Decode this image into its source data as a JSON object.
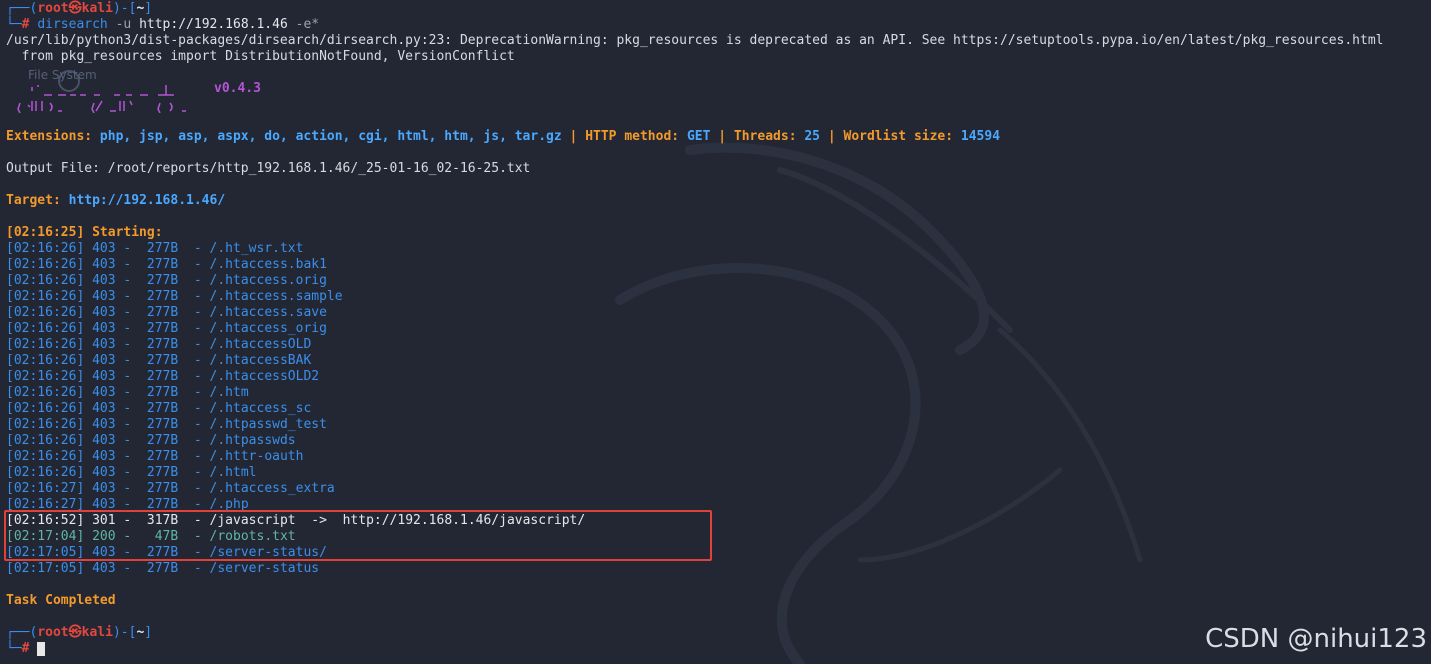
{
  "prompt1": {
    "user": "root",
    "at": "㉿",
    "host": "kali",
    "dir": "~",
    "hash": "#"
  },
  "command": {
    "name": "dirsearch",
    "flag_u": "-u",
    "url": "http://192.168.1.46",
    "flag_e": "-e*"
  },
  "warning": {
    "line1": "/usr/lib/python3/dist-packages/dirsearch/dirsearch.py:23: DeprecationWarning: pkg_resources is deprecated as an API. See https://setuptools.pypa.io/en/latest/pkg_resources.html",
    "line2": "  from pkg_resources import DistributionNotFound, VersionConflict"
  },
  "banner": {
    "version": "v0.4.3"
  },
  "config": {
    "ext_label": "Extensions:",
    "ext_value": "php, jsp, asp, aspx, do, action, cgi, html, htm, js, tar.gz",
    "method_label": "HTTP method:",
    "method_value": "GET",
    "threads_label": "Threads:",
    "threads_value": "25",
    "wordlist_label": "Wordlist size:",
    "wordlist_value": "14594",
    "sep": "|"
  },
  "output_file": "Output File: /root/reports/http_192.168.1.46/_25-01-16_02-16-25.txt",
  "target": {
    "label": "Target:",
    "url": "http://192.168.1.46/"
  },
  "starting": "[02:16:25] Starting:",
  "results": [
    {
      "time": "[02:16:26]",
      "code": "403",
      "size": "277B",
      "path": "/.ht_wsr.txt",
      "redirect": ""
    },
    {
      "time": "[02:16:26]",
      "code": "403",
      "size": "277B",
      "path": "/.htaccess.bak1",
      "redirect": ""
    },
    {
      "time": "[02:16:26]",
      "code": "403",
      "size": "277B",
      "path": "/.htaccess.orig",
      "redirect": ""
    },
    {
      "time": "[02:16:26]",
      "code": "403",
      "size": "277B",
      "path": "/.htaccess.sample",
      "redirect": ""
    },
    {
      "time": "[02:16:26]",
      "code": "403",
      "size": "277B",
      "path": "/.htaccess.save",
      "redirect": ""
    },
    {
      "time": "[02:16:26]",
      "code": "403",
      "size": "277B",
      "path": "/.htaccess_orig",
      "redirect": ""
    },
    {
      "time": "[02:16:26]",
      "code": "403",
      "size": "277B",
      "path": "/.htaccessOLD",
      "redirect": ""
    },
    {
      "time": "[02:16:26]",
      "code": "403",
      "size": "277B",
      "path": "/.htaccessBAK",
      "redirect": ""
    },
    {
      "time": "[02:16:26]",
      "code": "403",
      "size": "277B",
      "path": "/.htaccessOLD2",
      "redirect": ""
    },
    {
      "time": "[02:16:26]",
      "code": "403",
      "size": "277B",
      "path": "/.htm",
      "redirect": ""
    },
    {
      "time": "[02:16:26]",
      "code": "403",
      "size": "277B",
      "path": "/.htaccess_sc",
      "redirect": ""
    },
    {
      "time": "[02:16:26]",
      "code": "403",
      "size": "277B",
      "path": "/.htpasswd_test",
      "redirect": ""
    },
    {
      "time": "[02:16:26]",
      "code": "403",
      "size": "277B",
      "path": "/.htpasswds",
      "redirect": ""
    },
    {
      "time": "[02:16:26]",
      "code": "403",
      "size": "277B",
      "path": "/.httr-oauth",
      "redirect": ""
    },
    {
      "time": "[02:16:26]",
      "code": "403",
      "size": "277B",
      "path": "/.html",
      "redirect": ""
    },
    {
      "time": "[02:16:27]",
      "code": "403",
      "size": "277B",
      "path": "/.htaccess_extra",
      "redirect": ""
    },
    {
      "time": "[02:16:27]",
      "code": "403",
      "size": "277B",
      "path": "/.php",
      "redirect": ""
    },
    {
      "time": "[02:16:52]",
      "code": "301",
      "size": "317B",
      "path": "/javascript",
      "redirect": "->  http://192.168.1.46/javascript/"
    },
    {
      "time": "[02:17:04]",
      "code": "200",
      "size": " 47B",
      "path": "/robots.txt",
      "redirect": ""
    },
    {
      "time": "[02:17:05]",
      "code": "403",
      "size": "277B",
      "path": "/server-status/",
      "redirect": ""
    },
    {
      "time": "[02:17:05]",
      "code": "403",
      "size": "277B",
      "path": "/server-status",
      "redirect": ""
    }
  ],
  "task_completed": "Task Completed",
  "prompt2": {
    "user": "root",
    "at": "㉿",
    "host": "kali",
    "dir": "~",
    "hash": "#"
  },
  "watermark": "CSDN @nihui123",
  "ghost_label": "File System",
  "colors": {
    "background": "#232733",
    "accent_orange": "#f39a2b",
    "accent_blue": "#3b8eea",
    "prompt_red": "#e3483f",
    "highlight_box": "#e0423a"
  }
}
